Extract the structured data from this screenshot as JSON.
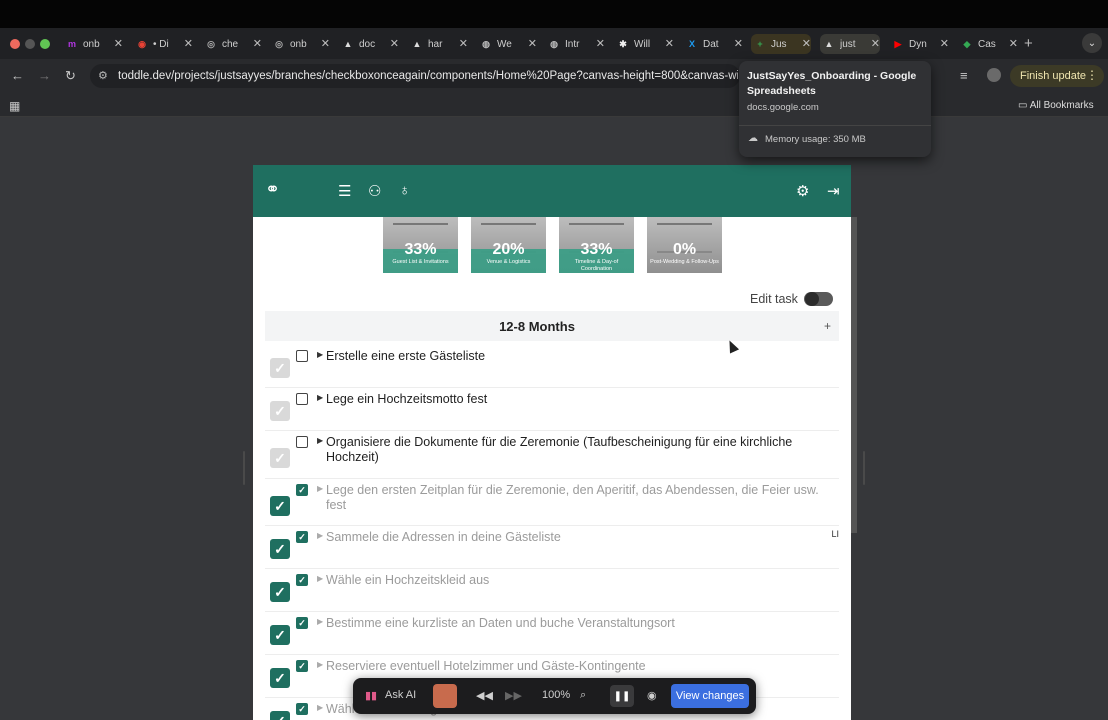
{
  "browser": {
    "tabs": [
      {
        "title": "onb",
        "fav": "m",
        "color": "#b036e0",
        "active": false
      },
      {
        "title": "• Di",
        "fav": "◉",
        "color": "#e94235",
        "active": false
      },
      {
        "title": "che",
        "fav": "◎",
        "color": "#aaaaaa",
        "active": false
      },
      {
        "title": "onb",
        "fav": "◎",
        "color": "#aaaaaa",
        "active": false
      },
      {
        "title": "doc",
        "fav": "▲",
        "color": "#dddddd",
        "active": false
      },
      {
        "title": "har",
        "fav": "▲",
        "color": "#dddddd",
        "active": false
      },
      {
        "title": "We",
        "fav": "◍",
        "color": "#bbbbbb",
        "active": false
      },
      {
        "title": "Intr",
        "fav": "◍",
        "color": "#bbbbbb",
        "active": false
      },
      {
        "title": "Will",
        "fav": "✱",
        "color": "#eeeeee",
        "active": false
      },
      {
        "title": "Dat",
        "fav": "X",
        "color": "#1d9bf0",
        "active": false
      },
      {
        "title": "Jus",
        "fav": "+",
        "color": "#34a853",
        "active": false
      },
      {
        "title": "just",
        "fav": "▲",
        "color": "#dddddd",
        "active": true
      },
      {
        "title": "Dyn",
        "fav": "▶",
        "color": "#ff0000",
        "active": false
      },
      {
        "title": "Cas",
        "fav": "◆",
        "color": "#34a853",
        "active": false
      }
    ],
    "url": "toddle.dev/projects/justsayyes/branches/checkboxonceagain/components/Home%20Page?canvas-height=800&canvas-widt",
    "finish_update": "Finish update",
    "all_bookmarks": "All Bookmarks",
    "hover_card": {
      "title": "JustSayYes_Onboarding - Google Spreadsheets",
      "domain": "docs.google.com",
      "memory": "Memory usage: 350 MB"
    }
  },
  "app": {
    "progress_cards": [
      {
        "percent": "33%",
        "label": "Guest List & Invitations",
        "fill": 0.33
      },
      {
        "percent": "20%",
        "label": "Venue & Logistics",
        "fill": 0.2
      },
      {
        "percent": "33%",
        "label": "Timeline & Day-of Coordination",
        "fill": 0.33
      },
      {
        "percent": "0%",
        "label": "Post-Wedding & Follow-Ups",
        "fill": 0.0
      }
    ],
    "edit_task_label": "Edit task",
    "section_title": "12-8 Months",
    "section_add": "+",
    "tasks": [
      {
        "text": "Erstelle eine erste Gästeliste",
        "done": false,
        "note": ""
      },
      {
        "text": "Lege ein Hochzeitsmotto fest",
        "done": false,
        "note": ""
      },
      {
        "text": "Organisiere die Dokumente für die Zeremonie (Taufbescheinigung für eine kirchliche Hochzeit)",
        "done": false,
        "note": ""
      },
      {
        "text": "Lege den ersten Zeitplan für die Zeremonie, den Aperitif, das Abendessen, die Feier usw. fest",
        "done": true,
        "note": ""
      },
      {
        "text": "Sammele die Adressen in deine Gästeliste",
        "done": true,
        "note": "LI"
      },
      {
        "text": "Wähle ein Hochzeitskleid aus",
        "done": true,
        "note": ""
      },
      {
        "text": "Bestimme eine kurzliste an Daten und buche Veranstaltungsort",
        "done": true,
        "note": ""
      },
      {
        "text": "Reserviere eventuell Hotelzimmer und Gäste-Kontingente",
        "done": true,
        "note": ""
      },
      {
        "text": "Wähle die Trauzeugen",
        "done": true,
        "note": ""
      }
    ]
  },
  "toolbar": {
    "ask_ai": "Ask AI",
    "zoom": "100%",
    "view_changes": "View changes"
  },
  "colors": {
    "brand": "#1f6f60",
    "accent_button": "#3b6fe0"
  }
}
